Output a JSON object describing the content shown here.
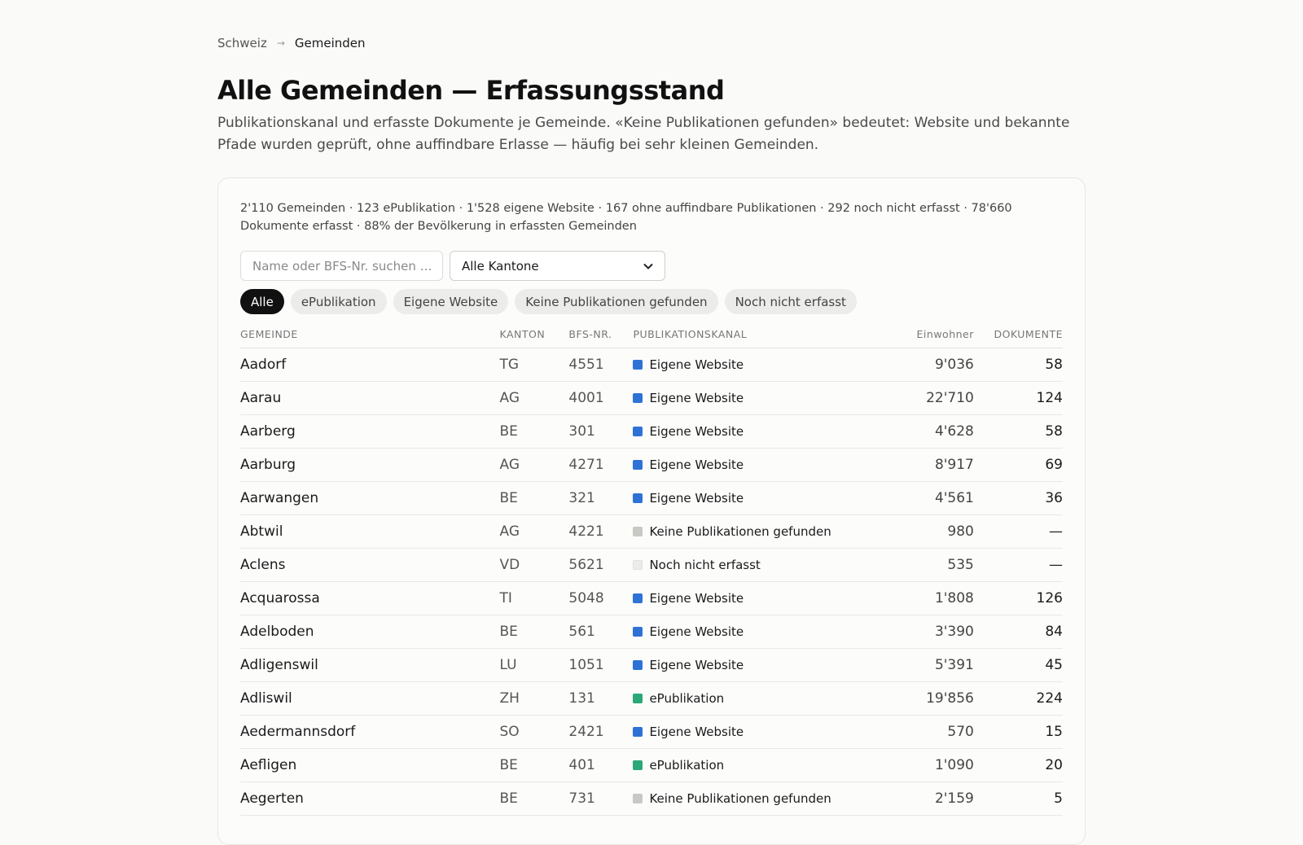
{
  "breadcrumb": {
    "root": "Schweiz",
    "separator": "→",
    "current": "Gemeinden"
  },
  "page": {
    "title": "Alle Gemeinden — Erfassungsstand",
    "subtitle": "Publikationskanal und erfasste Dokumente je Gemeinde. «Keine Publikationen gefunden» bedeutet: Website und bekannte Pfade wurden geprüft, ohne auffindbare Erlasse — häufig bei sehr kleinen Gemeinden."
  },
  "summary": "2'110 Gemeinden · 123 ePublikation · 1'528 eigene Website · 167 ohne auffindbare Publikationen · 292 noch nicht erfasst · 78'660 Dokumente erfasst · 88% der Bevölkerung in erfassten Gemeinden",
  "filters": {
    "search_placeholder": "Name oder BFS-Nr. suchen …",
    "search_value": "",
    "kanton_selected": "Alle Kantone",
    "chips": [
      "Alle",
      "ePublikation",
      "Eigene Website",
      "Keine Publikationen gefunden",
      "Noch nicht erfasst"
    ],
    "active_chip": "Alle"
  },
  "colors": {
    "Eigene Website": "#2f72d6",
    "ePublikation": "#2ba876",
    "Keine Publikationen gefunden": "#c8c8c4",
    "Noch nicht erfasst": "#ececea"
  },
  "table": {
    "headers": [
      "GEMEINDE",
      "KANTON",
      "BFS-NR.",
      "PUBLIKATIONSKANAL",
      "Einwohner",
      "DOKUMENTE"
    ],
    "rows": [
      [
        "Aadorf",
        "TG",
        "4551",
        "Eigene Website",
        "9'036",
        "58"
      ],
      [
        "Aarau",
        "AG",
        "4001",
        "Eigene Website",
        "22'710",
        "124"
      ],
      [
        "Aarberg",
        "BE",
        "301",
        "Eigene Website",
        "4'628",
        "58"
      ],
      [
        "Aarburg",
        "AG",
        "4271",
        "Eigene Website",
        "8'917",
        "69"
      ],
      [
        "Aarwangen",
        "BE",
        "321",
        "Eigene Website",
        "4'561",
        "36"
      ],
      [
        "Abtwil",
        "AG",
        "4221",
        "Keine Publikationen gefunden",
        "980",
        "—"
      ],
      [
        "Aclens",
        "VD",
        "5621",
        "Noch nicht erfasst",
        "535",
        "—"
      ],
      [
        "Acquarossa",
        "TI",
        "5048",
        "Eigene Website",
        "1'808",
        "126"
      ],
      [
        "Adelboden",
        "BE",
        "561",
        "Eigene Website",
        "3'390",
        "84"
      ],
      [
        "Adligenswil",
        "LU",
        "1051",
        "Eigene Website",
        "5'391",
        "45"
      ],
      [
        "Adliswil",
        "ZH",
        "131",
        "ePublikation",
        "19'856",
        "224"
      ],
      [
        "Aedermannsdorf",
        "SO",
        "2421",
        "Eigene Website",
        "570",
        "15"
      ],
      [
        "Aefligen",
        "BE",
        "401",
        "ePublikation",
        "1'090",
        "20"
      ],
      [
        "Aegerten",
        "BE",
        "731",
        "Keine Publikationen gefunden",
        "2'159",
        "5"
      ]
    ]
  }
}
